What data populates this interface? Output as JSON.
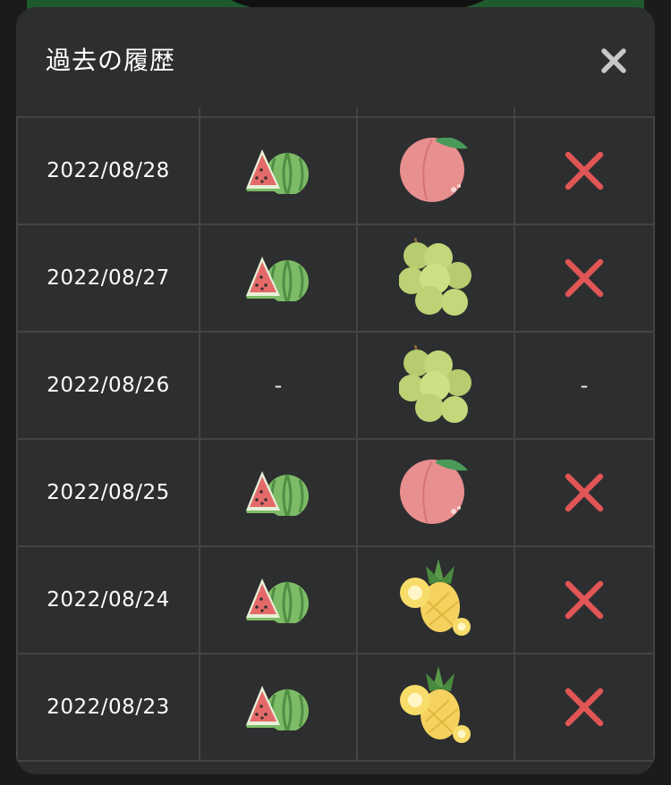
{
  "modal": {
    "title": "過去の履歴",
    "close_icon": "close-icon"
  },
  "history": [
    {
      "date": "2022/08/28",
      "pick": "watermelon",
      "answer": "peach",
      "result": "incorrect"
    },
    {
      "date": "2022/08/27",
      "pick": "watermelon",
      "answer": "grapes",
      "result": "incorrect"
    },
    {
      "date": "2022/08/26",
      "pick": "-",
      "answer": "grapes",
      "result": "-"
    },
    {
      "date": "2022/08/25",
      "pick": "watermelon",
      "answer": "peach",
      "result": "incorrect"
    },
    {
      "date": "2022/08/24",
      "pick": "watermelon",
      "answer": "pineapple",
      "result": "incorrect"
    },
    {
      "date": "2022/08/23",
      "pick": "watermelon",
      "answer": "pineapple",
      "result": "incorrect"
    }
  ],
  "colors": {
    "incorrect_mark": "#e05555",
    "modal_bg": "#2d2e2f",
    "grid_line": "#444444"
  }
}
